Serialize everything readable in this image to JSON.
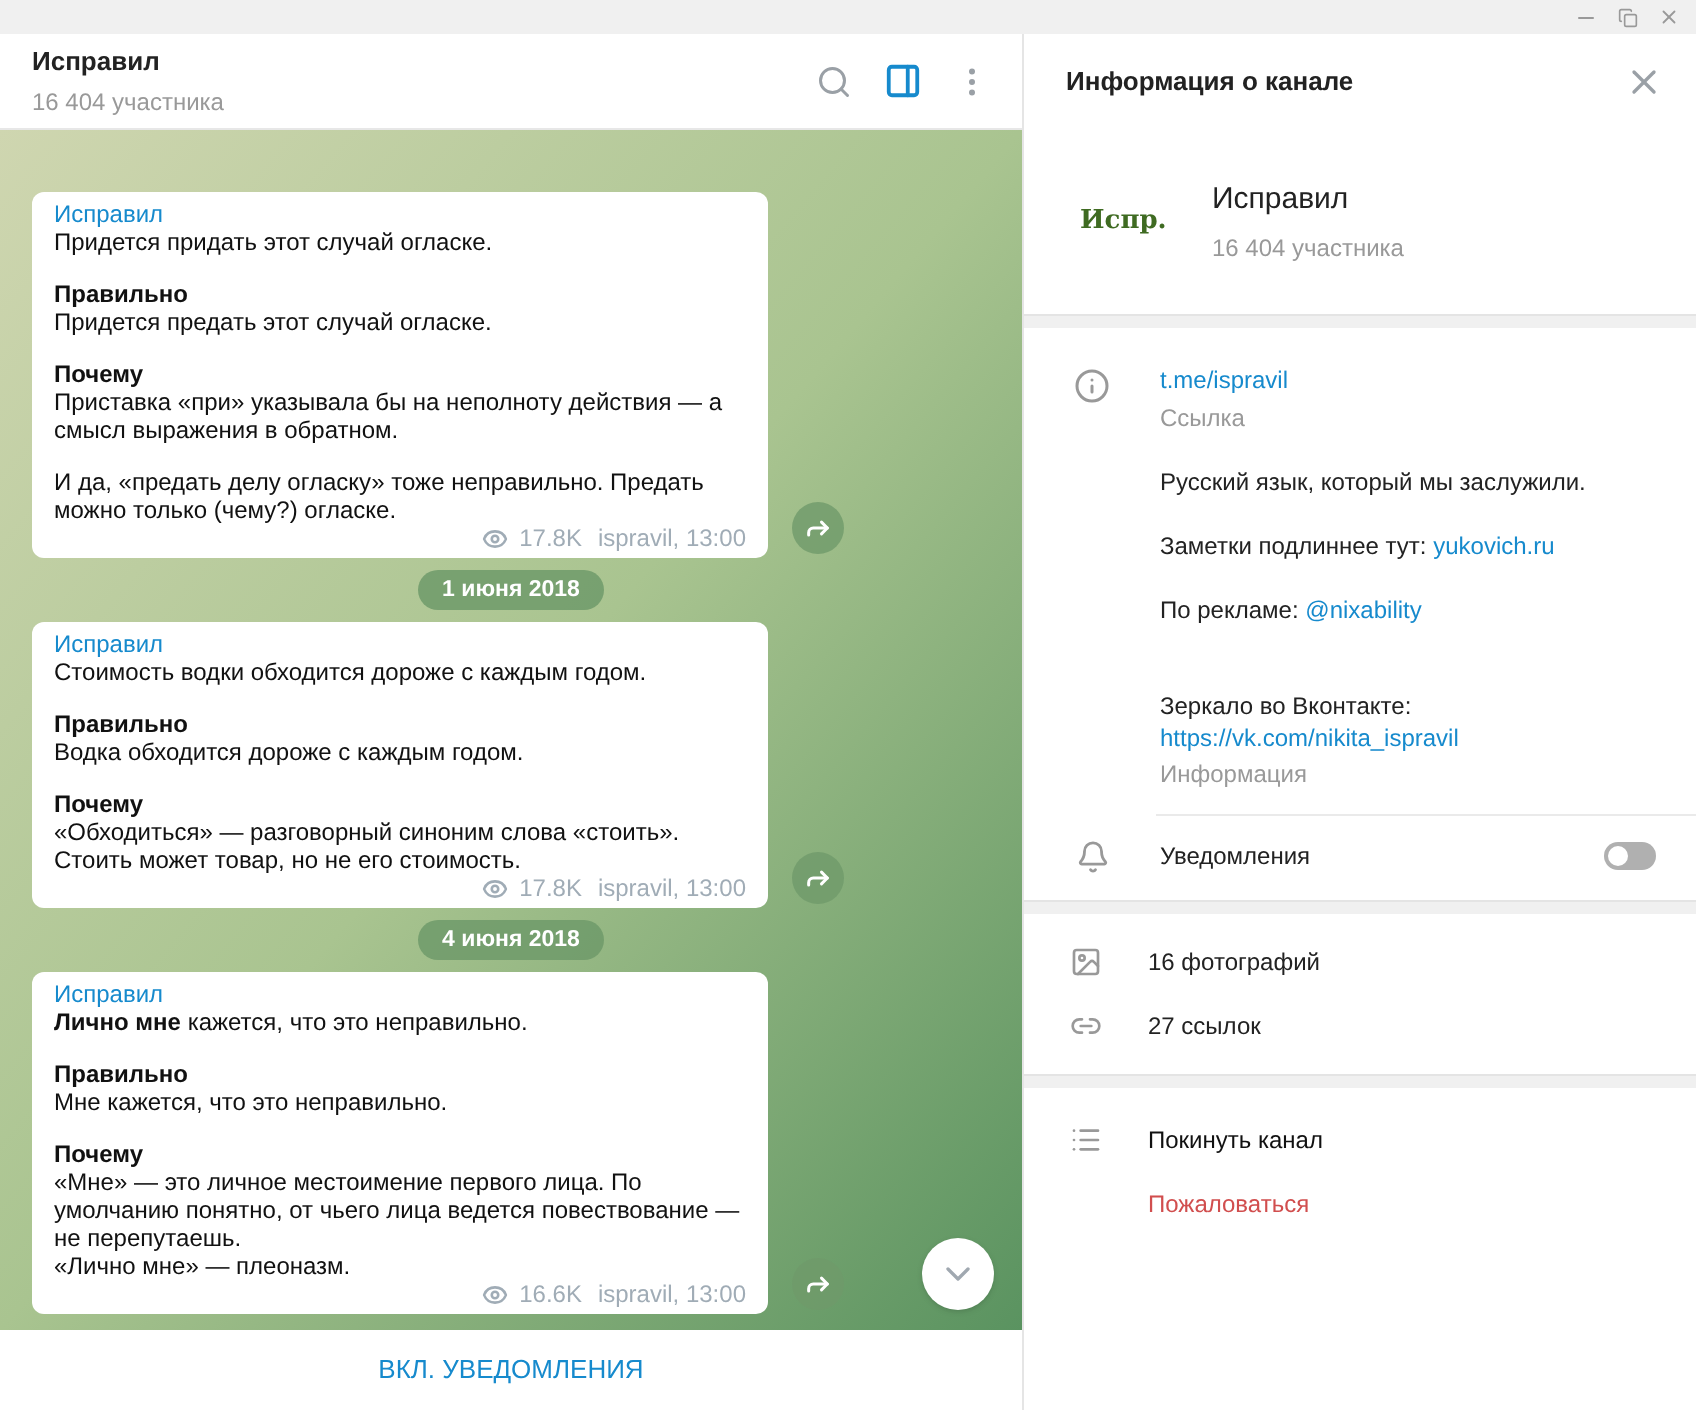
{
  "chat": {
    "title": "Исправил",
    "subtitle": "16 404 участника",
    "sidebar_toggle": {
      "selected": true
    },
    "items": [
      {
        "kind": "message",
        "author": "Исправил",
        "views": "17.8K",
        "signature": "ispravil, 13:00",
        "sections": [
          {
            "lines": [
              "Придется придать этот случай огласке."
            ]
          },
          {
            "heading": "Правильно",
            "lines": [
              "Придется предать этот случай огласке."
            ]
          },
          {
            "heading": "Почему",
            "lines": [
              "Приставка «при» указывала бы на неполноту действия — а смысл выражения в обратном."
            ]
          },
          {
            "lines": [
              "И да, «предать делу огласку» тоже неправильно. Предать можно только (чему?) огласке."
            ]
          }
        ]
      },
      {
        "kind": "date",
        "text": "1 июня 2018"
      },
      {
        "kind": "message",
        "author": "Исправил",
        "views": "17.8K",
        "signature": "ispravil, 13:00",
        "sections": [
          {
            "lines": [
              "Стоимость водки обходится дороже с каждым годом."
            ]
          },
          {
            "heading": "Правильно",
            "lines": [
              "Водка обходится дороже с каждым годом."
            ]
          },
          {
            "heading": "Почему",
            "lines": [
              "«Обходиться» — разговорный синоним слова «стоить». Стоить может товар, но не его стоимость."
            ]
          }
        ]
      },
      {
        "kind": "date",
        "text": "4 июня 2018"
      },
      {
        "kind": "message",
        "author": "Исправил",
        "views": "16.6K",
        "signature": "ispravil, 13:00",
        "sections": [
          {
            "lines": [
              "**Лично мне** кажется, что это неправильно."
            ]
          },
          {
            "heading": "Правильно",
            "lines": [
              "Мне кажется, что это неправильно."
            ]
          },
          {
            "heading": "Почему",
            "lines": [
              "«Мне» — это личное местоимение первого лица. По умолчанию понятно, от чьего лица ведется повествование — не перепутаешь.",
              "«Лично мне» — плеоназм."
            ]
          }
        ]
      }
    ],
    "footer_button": "ВКЛ. УВЕДОМЛЕНИЯ"
  },
  "info_panel": {
    "title": "Информация о канале",
    "avatar_text": "Испр.",
    "name": "Исправил",
    "subtitle": "16 404 участника",
    "link": "t.me/ispravil",
    "link_caption": "Ссылка",
    "description": [
      {
        "text": "Русский язык, который мы заслужили."
      },
      {
        "text": "Заметки подлиннее тут:",
        "link": "yukovich.ru"
      },
      {
        "text": "По рекламе:",
        "link": "@nixability"
      },
      {
        "text": "Зеркало во Вконтакте:",
        "link": "https://vk.com/nikita_ispravil",
        "link_on_new_line": true
      }
    ],
    "description_caption": "Информация",
    "notifications": {
      "label": "Уведомления",
      "on": false
    },
    "media": [
      {
        "kind": "photos",
        "text": "16 фотографий"
      },
      {
        "kind": "links",
        "text": "27 ссылок"
      }
    ],
    "actions": [
      {
        "kind": "normal",
        "text": "Покинуть канал"
      },
      {
        "kind": "danger",
        "text": "Пожаловаться"
      }
    ]
  }
}
